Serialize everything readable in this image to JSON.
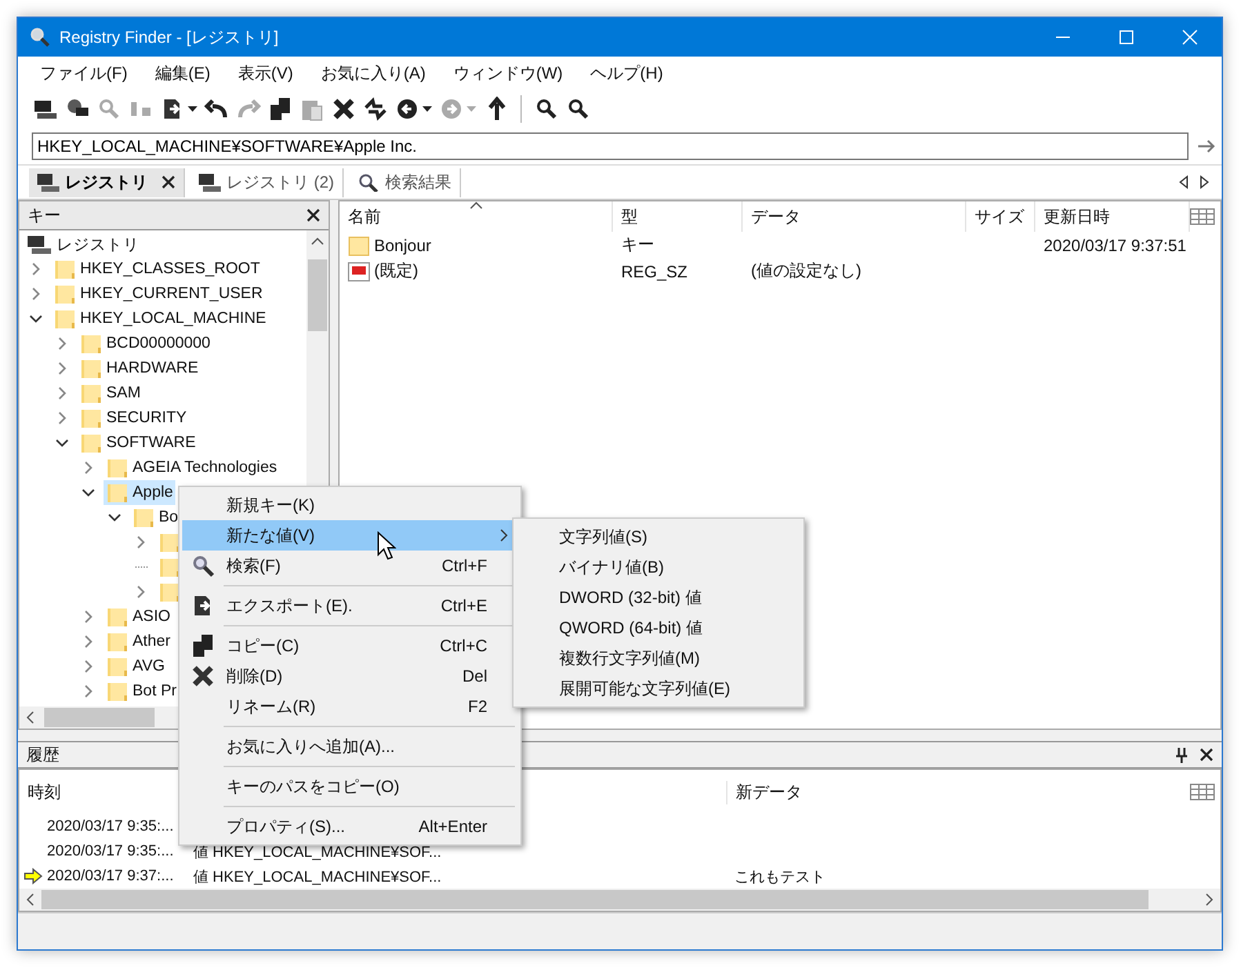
{
  "window": {
    "title": "Registry Finder - [レジストリ]"
  },
  "menu_bar": [
    "ファイル(F)",
    "編集(E)",
    "表示(V)",
    "お気に入り(A)",
    "ウィンドウ(W)",
    "ヘルプ(H)"
  ],
  "toolbar": [
    {
      "kind": "button",
      "disabled": false,
      "dropdown": false
    },
    {
      "kind": "button",
      "disabled": false,
      "dropdown": false
    },
    {
      "kind": "button",
      "disabled": true,
      "dropdown": false
    },
    {
      "kind": "button",
      "disabled": true,
      "dropdown": false
    },
    {
      "kind": "button",
      "disabled": false,
      "dropdown": true
    },
    {
      "kind": "button",
      "disabled": false,
      "dropdown": false
    },
    {
      "kind": "button",
      "disabled": true,
      "dropdown": false
    },
    {
      "kind": "button",
      "disabled": false,
      "dropdown": false
    },
    {
      "kind": "button",
      "disabled": true,
      "dropdown": false
    },
    {
      "kind": "button",
      "disabled": false,
      "dropdown": false
    },
    {
      "kind": "button",
      "disabled": false,
      "dropdown": false
    },
    {
      "kind": "button",
      "disabled": false,
      "dropdown": true
    },
    {
      "kind": "button",
      "disabled": true,
      "dropdown": true
    },
    {
      "kind": "button",
      "disabled": false,
      "dropdown": false
    },
    {
      "kind": "separator"
    },
    {
      "kind": "button",
      "disabled": false,
      "dropdown": false
    },
    {
      "kind": "button",
      "disabled": false,
      "dropdown": false
    }
  ],
  "address": {
    "value": "HKEY_LOCAL_MACHINE¥SOFTWARE¥Apple Inc."
  },
  "tabs": [
    {
      "label": "レジストリ",
      "selected": true,
      "closable": true
    },
    {
      "label": "レジストリ (2)",
      "selected": false,
      "closable": false
    },
    {
      "label": "検索結果",
      "selected": false,
      "closable": false
    }
  ],
  "tree": {
    "header": "キー",
    "root": {
      "label": "レジストリ",
      "selected": false,
      "children": [
        {
          "label": "HKEY_CLASSES_ROOT",
          "expanded": false,
          "selected": false
        },
        {
          "label": "HKEY_CURRENT_USER",
          "expanded": false,
          "selected": false
        },
        {
          "label": "HKEY_LOCAL_MACHINE",
          "expanded": true,
          "selected": false,
          "children": [
            {
              "label": "BCD00000000",
              "expanded": false,
              "selected": false
            },
            {
              "label": "HARDWARE",
              "expanded": false,
              "selected": false
            },
            {
              "label": "SAM",
              "expanded": false,
              "selected": false
            },
            {
              "label": "SECURITY",
              "expanded": false,
              "selected": false
            },
            {
              "label": "SOFTWARE",
              "expanded": true,
              "selected": false,
              "children": [
                {
                  "label": "AGEIA Technologies",
                  "expanded": false,
                  "selected": false
                },
                {
                  "label": "Apple",
                  "expanded": true,
                  "selected": true,
                  "children": [
                    {
                      "label": "Bo",
                      "expanded": true,
                      "selected": false,
                      "children": [
                        {
                          "expanded": false,
                          "selected": false
                        },
                        {
                          "leaf": true,
                          "selected": false
                        },
                        {
                          "expanded": false,
                          "selected": false
                        }
                      ]
                    }
                  ]
                },
                {
                  "label": "ASIO",
                  "expanded": false,
                  "selected": false
                },
                {
                  "label": "Ather",
                  "expanded": false,
                  "selected": false
                },
                {
                  "label": "AVG",
                  "expanded": false,
                  "selected": false
                },
                {
                  "label": "Bot Pr",
                  "expanded": false,
                  "selected": false
                }
              ]
            }
          ]
        }
      ]
    }
  },
  "list": {
    "columns": [
      {
        "label": "名前",
        "sorted": true
      },
      {
        "label": "型",
        "sorted": false
      },
      {
        "label": "データ",
        "sorted": false
      },
      {
        "label": "サイズ",
        "sorted": false
      },
      {
        "label": "更新日時",
        "sorted": false
      }
    ],
    "rows": [
      {
        "kind": "key",
        "name": "Bonjour",
        "type": "キー",
        "modified": "2020/03/17 9:37:51"
      },
      {
        "kind": "string",
        "name": "(既定)",
        "type": "REG_SZ",
        "data": "(値の設定なし)"
      }
    ]
  },
  "history": {
    "title": "履歴",
    "columns": [
      "時刻",
      "新データ"
    ],
    "rows": [
      {
        "time": "2020/03/17 9:35:...",
        "current": false
      },
      {
        "time": "2020/03/17 9:35:...",
        "target": "値 HKEY_LOCAL_MACHINE¥SOF...",
        "current": false
      },
      {
        "time": "2020/03/17 9:37:...",
        "target": "値 HKEY_LOCAL_MACHINE¥SOF...",
        "new_data": "これもテスト",
        "current": true
      }
    ]
  },
  "context_menu": {
    "items": [
      {
        "kind": "item",
        "label": "新規キー(K)",
        "selected": false,
        "submenu": false
      },
      {
        "kind": "item",
        "label": "新たな値(V)",
        "selected": true,
        "submenu": true
      },
      {
        "kind": "item",
        "label": "検索(F)",
        "shortcut": "Ctrl+F",
        "selected": false,
        "submenu": false
      },
      {
        "kind": "separator"
      },
      {
        "kind": "item",
        "label": "エクスポート(E).",
        "shortcut": "Ctrl+E",
        "selected": false,
        "submenu": false
      },
      {
        "kind": "separator"
      },
      {
        "kind": "item",
        "label": "コピー(C)",
        "shortcut": "Ctrl+C",
        "selected": false,
        "submenu": false
      },
      {
        "kind": "item",
        "label": "削除(D)",
        "shortcut": "Del",
        "selected": false,
        "submenu": false
      },
      {
        "kind": "item",
        "label": "リネーム(R)",
        "shortcut": "F2",
        "selected": false,
        "submenu": false
      },
      {
        "kind": "separator"
      },
      {
        "kind": "item",
        "label": "お気に入りへ追加(A)...",
        "selected": false,
        "submenu": false
      },
      {
        "kind": "separator"
      },
      {
        "kind": "item",
        "label": "キーのパスをコピー(O)",
        "selected": false,
        "submenu": false
      },
      {
        "kind": "separator"
      },
      {
        "kind": "item",
        "label": "プロパティ(S)...",
        "shortcut": "Alt+Enter",
        "selected": false,
        "submenu": false
      }
    ]
  },
  "submenu": {
    "items": [
      "文字列値(S)",
      "バイナリ値(B)",
      "DWORD (32-bit) 値",
      "QWORD (64-bit) 値",
      "複数行文字列値(M)",
      "展開可能な文字列値(E)"
    ]
  }
}
